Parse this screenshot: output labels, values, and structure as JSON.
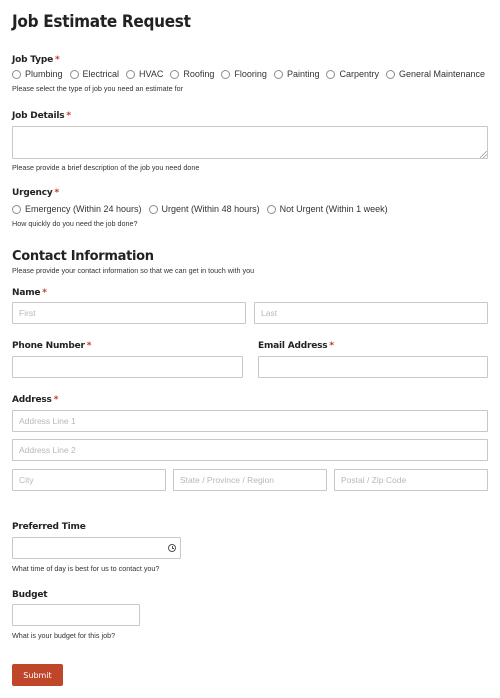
{
  "form": {
    "title": "Job Estimate Request",
    "job_type": {
      "label": "Job Type",
      "required": "*",
      "options": [
        "Plumbing",
        "Electrical",
        "HVAC",
        "Roofing",
        "Flooring",
        "Painting",
        "Carpentry",
        "General Maintenance"
      ],
      "hint": "Please select the type of job you need an estimate for"
    },
    "job_details": {
      "label": "Job Details",
      "required": "*",
      "hint": "Please provide a brief description of the job you need done"
    },
    "urgency": {
      "label": "Urgency",
      "required": "*",
      "options": [
        "Emergency (Within 24 hours)",
        "Urgent (Within 48 hours)",
        "Not Urgent (Within 1 week)"
      ],
      "hint": "How quickly do you need the job done?"
    },
    "contact": {
      "title": "Contact Information",
      "subtitle": "Please provide your contact information so that we can get in touch with you"
    },
    "name": {
      "label": "Name",
      "required": "*",
      "first_placeholder": "First",
      "last_placeholder": "Last"
    },
    "phone": {
      "label": "Phone Number",
      "required": "*"
    },
    "email": {
      "label": "Email Address",
      "required": "*"
    },
    "address": {
      "label": "Address",
      "required": "*",
      "line1_placeholder": "Address Line 1",
      "line2_placeholder": "Address Line 2",
      "city_placeholder": "City",
      "state_placeholder": "State / Province / Region",
      "zip_placeholder": "Postal / Zip Code"
    },
    "preferred_time": {
      "label": "Preferred Time",
      "icon": "clock-icon",
      "hint": "What time of day is best for us to contact you?"
    },
    "budget": {
      "label": "Budget",
      "hint": "What is your budget for this job?"
    },
    "submit_label": "Submit",
    "colors": {
      "required": "#c0392b",
      "submit_bg": "#c0462a",
      "border": "#c8c8c8"
    }
  }
}
